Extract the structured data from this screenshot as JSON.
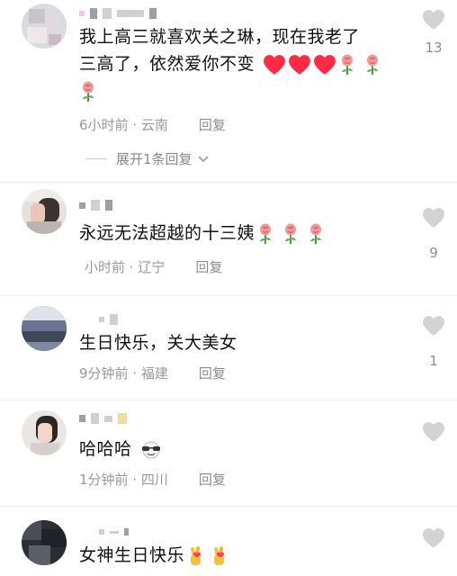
{
  "comments": [
    {
      "text_line1": "我上高三就喜欢关之琳，现在我老了",
      "text_line2": "三高了，依然爱你不变",
      "time": "6小时前",
      "region": "云南",
      "reply": "回复",
      "likes": "13",
      "expand": "展开1条回复"
    },
    {
      "text": "永远无法超越的十三姨",
      "time": "小时前",
      "region": "辽宁",
      "reply": "回复",
      "likes": "9"
    },
    {
      "text": "生日快乐，关大美女",
      "time": "9分钟前",
      "region": "福建",
      "reply": "回复",
      "likes": "1"
    },
    {
      "text": "哈哈哈",
      "time": "1分钟前",
      "region": "四川",
      "reply": "回复",
      "likes": ""
    },
    {
      "text": "女神生日快乐",
      "likes": ""
    }
  ],
  "icons": {
    "like": "heart-outline-icon",
    "heart_emoji": "red-heart-icon",
    "rose_emoji": "rose-icon",
    "fingers_emoji": "crossed-fingers-icon",
    "sunglasses_emoji": "sunglasses-icon",
    "chevron": "chevron-down-icon"
  },
  "colors": {
    "like_grey": "#cfcfcf",
    "meta_grey": "#9a9a9a",
    "heart_red": "#ff2b45",
    "rose_pink": "#f08a8a"
  }
}
